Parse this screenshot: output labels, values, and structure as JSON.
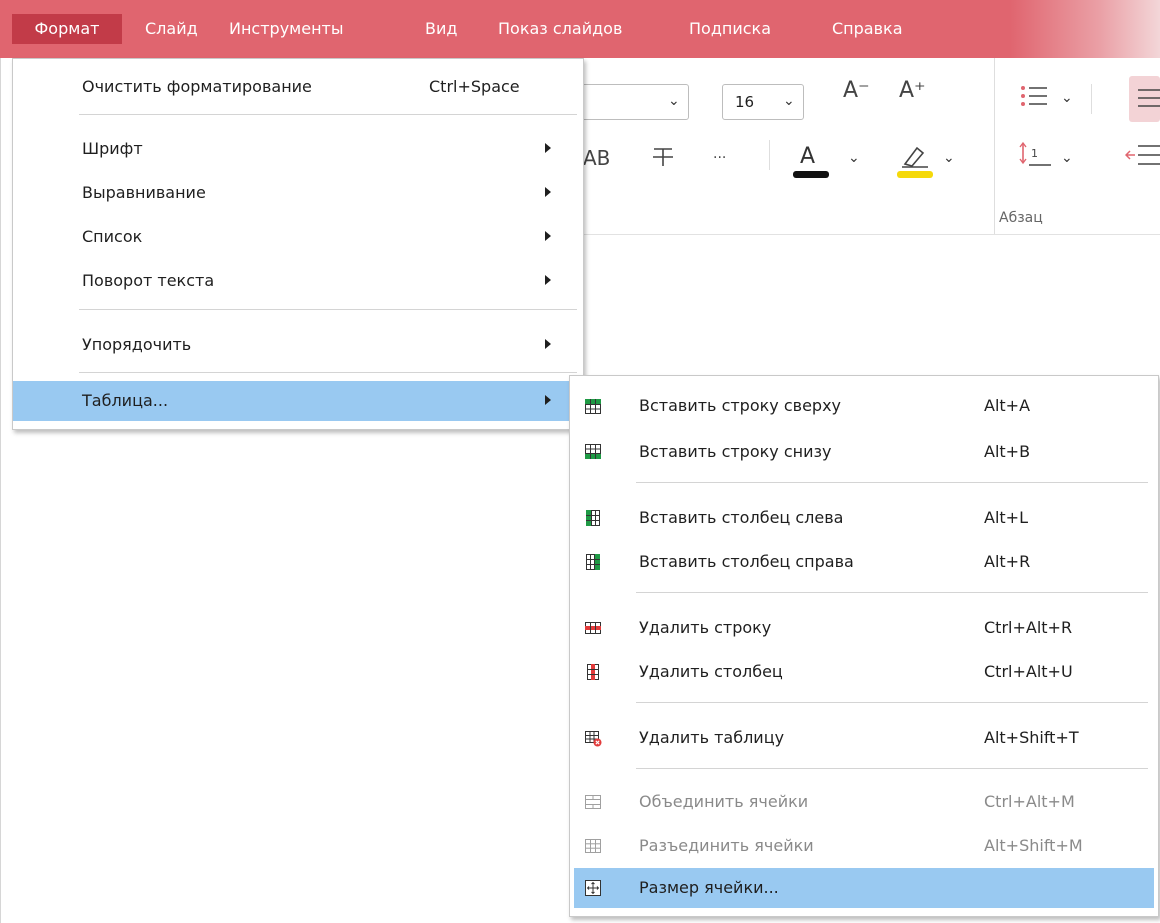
{
  "menubar": {
    "items": [
      "Формат",
      "Слайд",
      "Инструменты",
      "Вид",
      "Показ слайдов",
      "Подписка",
      "Справка"
    ]
  },
  "colors": {
    "menubar": "#e0656f",
    "active": "#c23b48",
    "highlight": "#99c9f1"
  },
  "ribbon": {
    "font_size": "16",
    "decrease_font_label": "A⁻",
    "increase_font_label": "A⁺",
    "strike_label": "AB",
    "more_label": "···",
    "paragraph_group_label": "Абзац"
  },
  "format_menu": {
    "clear_label": "Очистить форматирование",
    "clear_shortcut": "Ctrl+Space",
    "font": "Шрифт",
    "align": "Выравнивание",
    "list": "Список",
    "rotate": "Поворот текста",
    "arrange": "Упорядочить",
    "table": "Таблица..."
  },
  "table_menu": {
    "items": [
      {
        "label": "Вставить строку сверху",
        "shortcut": "Alt+A",
        "icon": "insert-row-above-icon",
        "enabled": true
      },
      {
        "label": "Вставить строку снизу",
        "shortcut": "Alt+B",
        "icon": "insert-row-below-icon",
        "enabled": true
      },
      {
        "label": "Вставить столбец слева",
        "shortcut": "Alt+L",
        "icon": "insert-column-left-icon",
        "enabled": true
      },
      {
        "label": "Вставить столбец справа",
        "shortcut": "Alt+R",
        "icon": "insert-column-right-icon",
        "enabled": true
      },
      {
        "label": "Удалить строку",
        "shortcut": "Ctrl+Alt+R",
        "icon": "delete-row-icon",
        "enabled": true
      },
      {
        "label": "Удалить столбец",
        "shortcut": "Ctrl+Alt+U",
        "icon": "delete-column-icon",
        "enabled": true
      },
      {
        "label": "Удалить таблицу",
        "shortcut": "Alt+Shift+T",
        "icon": "delete-table-icon",
        "enabled": true
      },
      {
        "label": "Объединить ячейки",
        "shortcut": "Ctrl+Alt+M",
        "icon": "merge-cells-icon",
        "enabled": false
      },
      {
        "label": "Разъединить ячейки",
        "shortcut": "Alt+Shift+M",
        "icon": "split-cells-icon",
        "enabled": false
      },
      {
        "label": "Размер ячейки...",
        "shortcut": "",
        "icon": "cell-size-icon",
        "enabled": true
      }
    ]
  }
}
